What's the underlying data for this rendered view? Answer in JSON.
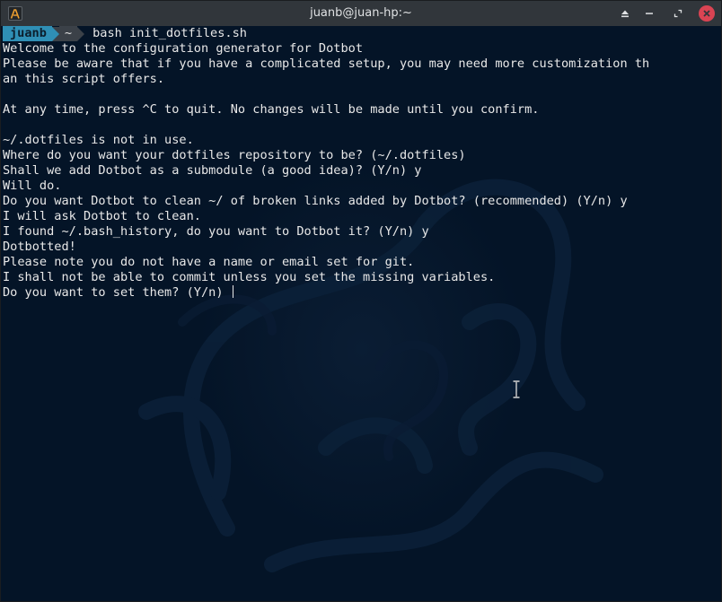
{
  "window": {
    "title": "juanb@juan-hp:~",
    "icons": [
      "app-icon",
      "keep-above-icon",
      "minimize-icon",
      "maximize-icon",
      "close-icon"
    ]
  },
  "prompt": {
    "user": "juanb",
    "dir": "~",
    "command": "bash init_dotfiles.sh"
  },
  "output": [
    "Welcome to the configuration generator for Dotbot",
    "Please be aware that if you have a complicated setup, you may need more customization th",
    "an this script offers.",
    "",
    "At any time, press ^C to quit. No changes will be made until you confirm.",
    "",
    "~/.dotfiles is not in use.",
    "Where do you want your dotfiles repository to be? (~/.dotfiles)",
    "Shall we add Dotbot as a submodule (a good idea)? (Y/n) y",
    "Will do.",
    "Do you want Dotbot to clean ~/ of broken links added by Dotbot? (recommended) (Y/n) y",
    "I will ask Dotbot to clean.",
    "I found ~/.bash_history, do you want to Dotbot it? (Y/n) y",
    "Dotbotted!",
    "Please note you do not have a name or email set for git.",
    "I shall not be able to commit unless you set the missing variables."
  ],
  "current_line": "Do you want to set them? (Y/n) ",
  "colors": {
    "terminal_bg": "#041427",
    "titlebar_bg": "#31363b",
    "prompt_user_bg": "#2f8fb5",
    "prompt_dir_bg": "#3b4148",
    "close_button": "#da4453"
  }
}
